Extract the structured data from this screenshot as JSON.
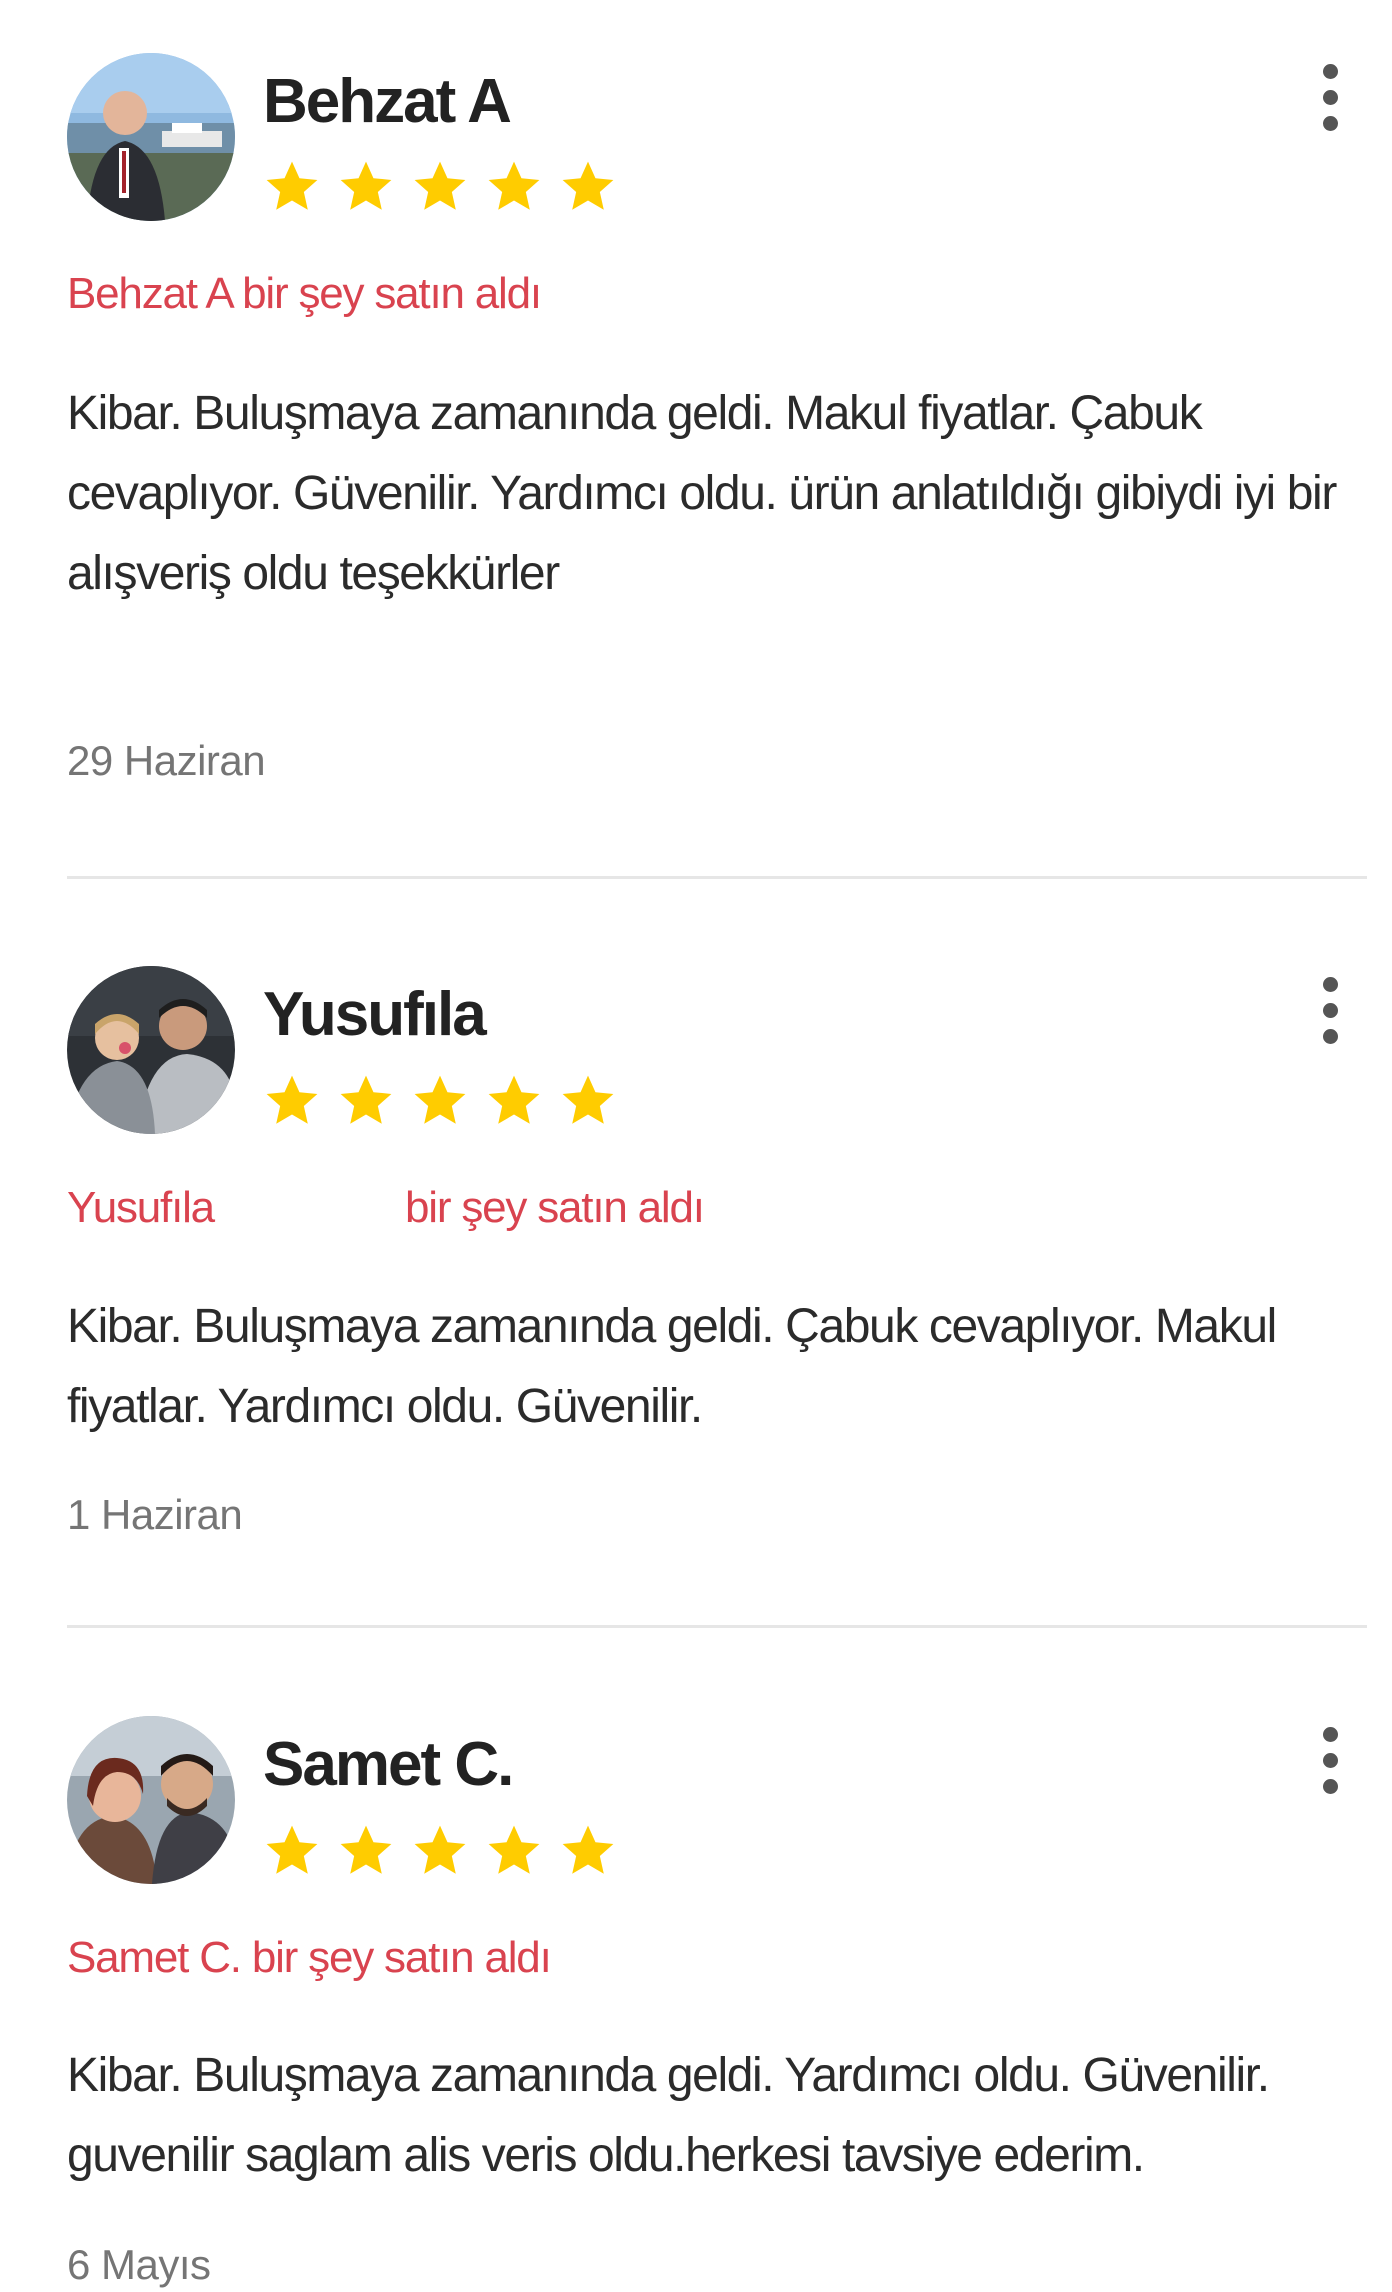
{
  "colors": {
    "accent": "#d9434f",
    "star": "#ffcc00",
    "text": "#2b2b2b",
    "date": "#757575",
    "divider": "#e6e6e6"
  },
  "icons": {
    "star": "star-icon",
    "more": "more-vertical-icon"
  },
  "reviews": [
    {
      "name": "Behzat A",
      "rating": 5,
      "purchase_name": "Behzat A",
      "purchase_suffix": "bir şey satın aldı",
      "text": "Kibar. Buluşmaya zamanında geldi. Makul fiyatlar. Çabuk cevaplıyor. Güvenilir. Yardımcı oldu. ürün anlatıldığı gibiydi iyi bir alışveriş oldu teşekkürler",
      "date": "29 Haziran"
    },
    {
      "name": "Yusufıla",
      "rating": 5,
      "purchase_name": "Yusufıla",
      "purchase_suffix": "bir şey satın aldı",
      "text": "Kibar. Buluşmaya zamanında geldi. Çabuk cevaplıyor. Makul fiyatlar. Yardımcı oldu. Güvenilir.",
      "date": "1 Haziran"
    },
    {
      "name": "Samet C.",
      "rating": 5,
      "purchase_name": "Samet C.",
      "purchase_suffix": "bir şey satın aldı",
      "text": "Kibar. Buluşmaya zamanında geldi. Yardımcı oldu. Güvenilir. guvenilir saglam alis veris oldu.herkesi tavsiye ederim.",
      "date": "6 Mayıs"
    }
  ]
}
